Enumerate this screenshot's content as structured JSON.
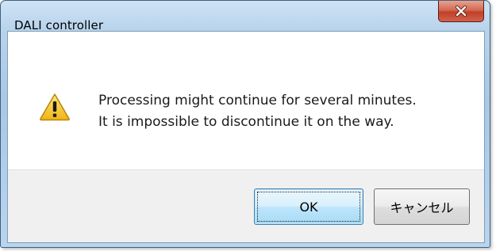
{
  "window": {
    "title": "DALI controller",
    "close_icon": "close-icon"
  },
  "message": {
    "icon": "warning-icon",
    "line1": "Processing might continue for several minutes.",
    "line2": "It is impossible to discontinue it on the way."
  },
  "buttons": {
    "ok_label": "OK",
    "cancel_label": "キャンセル"
  },
  "colors": {
    "close_button": "#c24027",
    "titlebar": "#b8d3ec",
    "warning_fill": "#f5c51e",
    "ok_border": "#3c7fb1"
  }
}
